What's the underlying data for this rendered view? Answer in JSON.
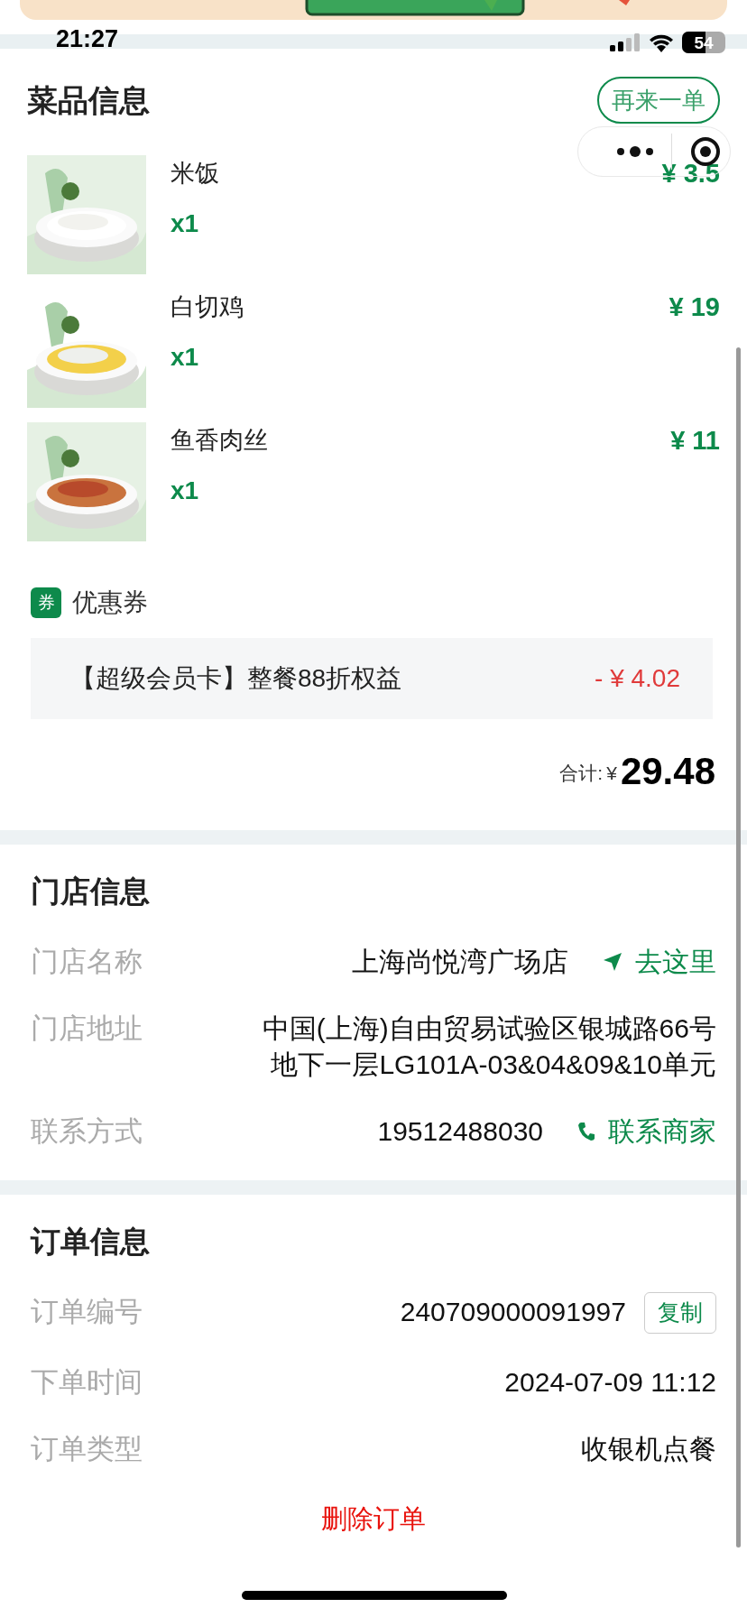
{
  "status_bar": {
    "time": "21:27",
    "battery": "54"
  },
  "dishes": {
    "title": "菜品信息",
    "reorder_button": "再来一单",
    "items": [
      {
        "name": "米饭",
        "quantity": "x1",
        "price": "¥ 3.5"
      },
      {
        "name": "白切鸡",
        "quantity": "x1",
        "price": "¥ 19"
      },
      {
        "name": "鱼香肉丝",
        "quantity": "x1",
        "price": "¥ 11"
      }
    ]
  },
  "coupon": {
    "badge": "券",
    "label": "优惠券",
    "items": [
      {
        "name": "【超级会员卡】整餐88折权益",
        "amount": "- ¥ 4.02"
      }
    ]
  },
  "total": {
    "label": "合计:",
    "currency": "¥",
    "amount": "29.48"
  },
  "store": {
    "title": "门店信息",
    "rows": [
      {
        "kind": "navigate",
        "label": "门店名称",
        "value": [
          "上海尚悦湾广场店"
        ],
        "action": "去这里"
      },
      {
        "kind": "plain",
        "label": "门店地址",
        "value": [
          "中国(上海)自由贸易试验区银城路66号",
          "地下一层LG101A-03&04&09&10单元"
        ]
      },
      {
        "kind": "call",
        "label": "联系方式",
        "value": [
          "19512488030"
        ],
        "action": "联系商家"
      }
    ]
  },
  "order": {
    "title": "订单信息",
    "rows": [
      {
        "kind": "copy",
        "label": "订单编号",
        "value": [
          "240709000091997"
        ],
        "action": "复制"
      },
      {
        "kind": "plain",
        "label": "下单时间",
        "value": [
          "2024-07-09 11:12"
        ]
      },
      {
        "kind": "plain",
        "label": "订单类型",
        "value": [
          "收银机点餐"
        ]
      }
    ],
    "delete_button": "删除订单"
  }
}
